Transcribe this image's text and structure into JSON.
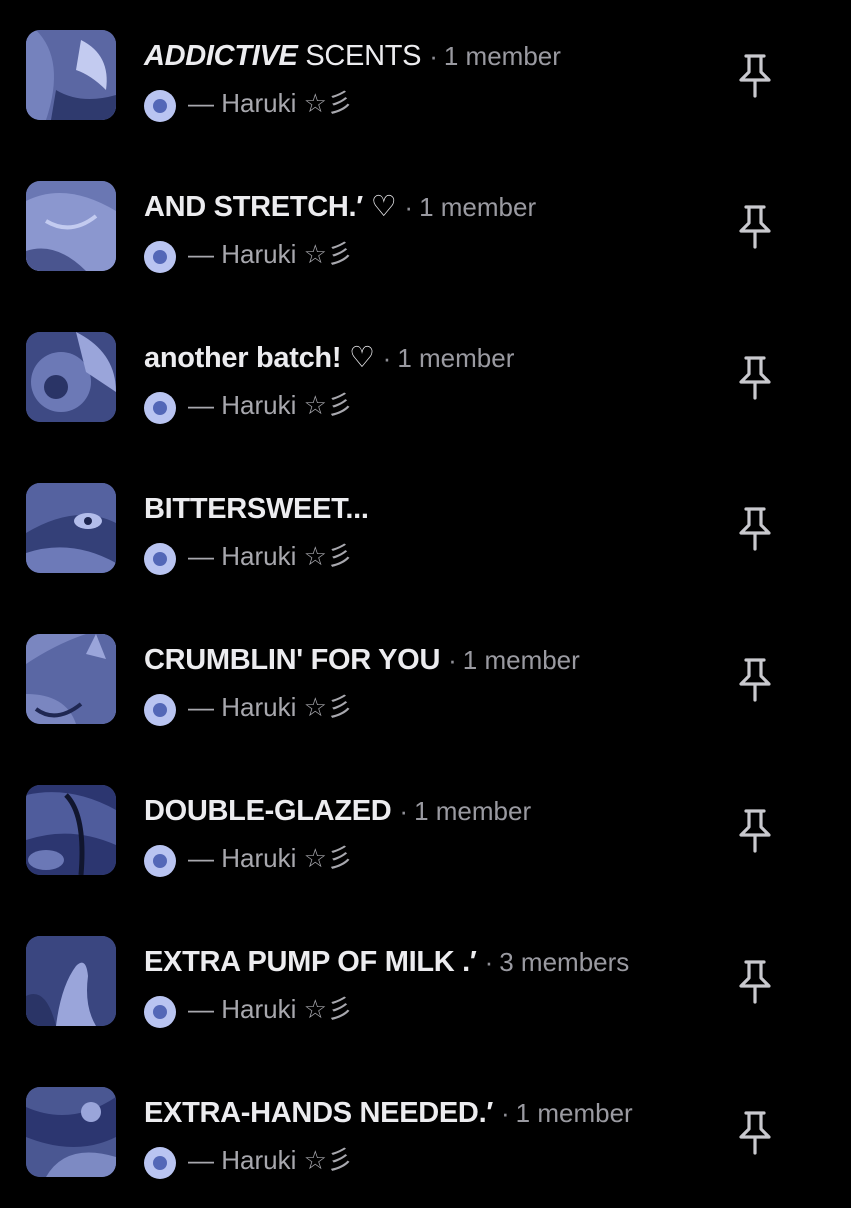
{
  "groups": [
    {
      "title_prefix": "ADDICTIVE",
      "title": " SCENTS",
      "members": "1 member",
      "owner": "— Haruki ☆彡"
    },
    {
      "title_prefix": "",
      "title": "AND STRETCH.′ ♡",
      "members": "1 member",
      "owner": "— Haruki ☆彡"
    },
    {
      "title_prefix": "",
      "title": "another batch! ♡",
      "members": "1 member",
      "owner": "— Haruki ☆彡"
    },
    {
      "title_prefix": "",
      "title": "BITTERSWEET...",
      "members": "",
      "owner": "— Haruki ☆彡"
    },
    {
      "title_prefix": "",
      "title": "CRUMBLIN' FOR YOU",
      "members": "1 member",
      "owner": "— Haruki ☆彡"
    },
    {
      "title_prefix": "",
      "title": "DOUBLE-GLAZED",
      "members": "1 member",
      "owner": "— Haruki ☆彡"
    },
    {
      "title_prefix": "",
      "title": "EXTRA PUMP OF MILK .′",
      "members": "3 members",
      "owner": "— Haruki ☆彡"
    },
    {
      "title_prefix": "",
      "title": "EXTRA-HANDS NEEDED.′",
      "members": "1 member",
      "owner": "— Haruki ☆彡"
    }
  ],
  "separator": "·",
  "icons": {
    "pin": "pin-icon",
    "avatar": "owner-avatar"
  },
  "colors": {
    "background": "#000000",
    "thumbnail_tint": "#4d5a92",
    "title": "#ececef",
    "meta": "#9a9aa1"
  }
}
